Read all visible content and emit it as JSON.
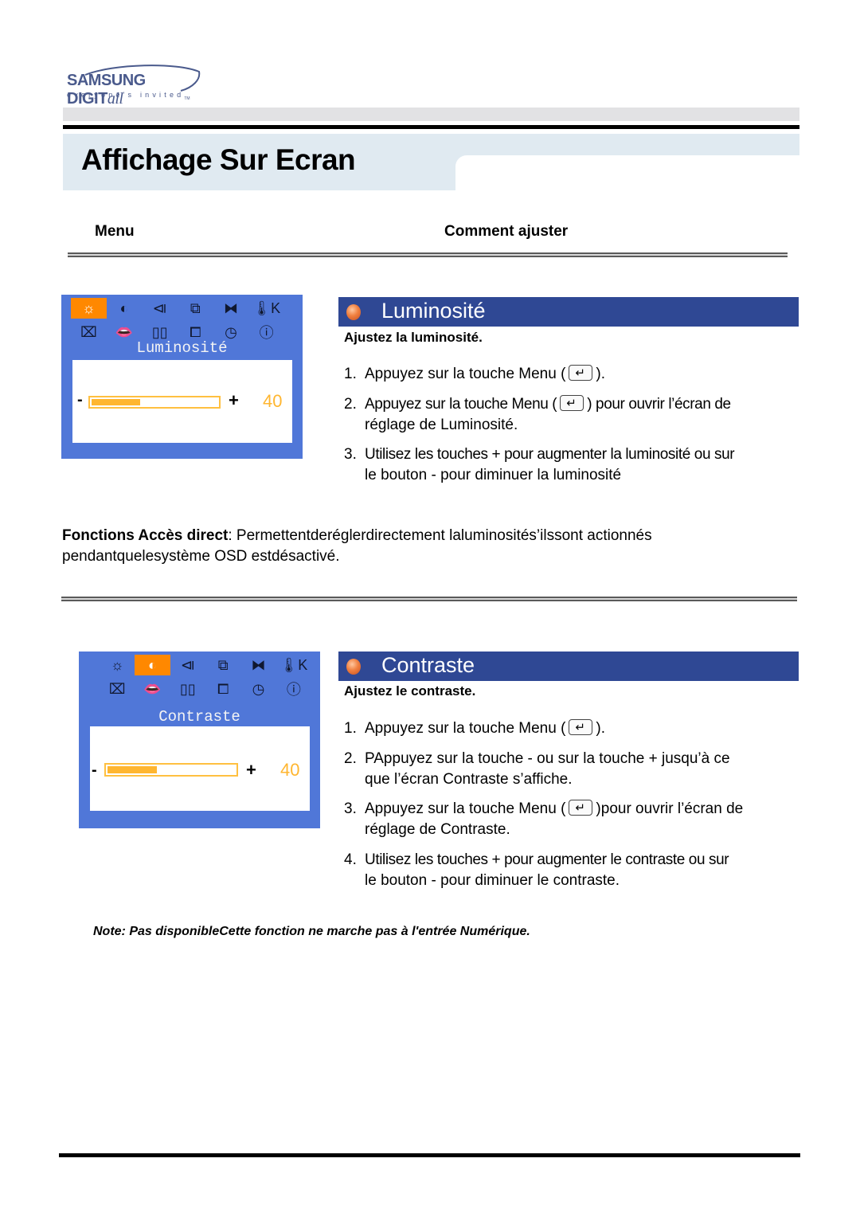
{
  "logo": {
    "brand": "SAMSUNG DIGIT",
    "brand_suffix": "all",
    "tagline": "everyone's invited",
    "tm": "TM"
  },
  "header": {
    "title": "Affichage Sur Ecran"
  },
  "columns": {
    "menu": "Menu",
    "how": "Comment ajuster"
  },
  "osd_icons": [
    {
      "name": "brightness-icon",
      "glyph": "☼"
    },
    {
      "name": "contrast-icon",
      "glyph": "◐"
    },
    {
      "name": "image-lock-icon",
      "glyph": "⧏"
    },
    {
      "name": "position-icon",
      "glyph": "⧉"
    },
    {
      "name": "size-icon",
      "glyph": "⧓"
    },
    {
      "name": "color-temp-icon",
      "glyph": "🌡K"
    },
    {
      "name": "geometry-icon",
      "glyph": "⌧"
    },
    {
      "name": "language-icon",
      "glyph": "👄"
    },
    {
      "name": "zoom-icon",
      "glyph": "▯▯"
    },
    {
      "name": "pip-icon",
      "glyph": "⧠"
    },
    {
      "name": "osd-time-icon",
      "glyph": "◷"
    },
    {
      "name": "info-icon",
      "glyph": "ⓘ"
    }
  ],
  "sections": [
    {
      "id": "luminosite",
      "osd_title": "Luminosité",
      "osd_value": "40",
      "osd_level_percent": 40,
      "osd_minus": "-",
      "osd_plus": "+",
      "selected_icon_index": 0,
      "banner": "Luminosité",
      "subhead": "Ajustez la luminosité.",
      "steps": [
        {
          "num": "1.",
          "before": "Appuyez sur la touche Menu (",
          "after": ").",
          "line2": ""
        },
        {
          "num": "2.",
          "before": "Appuyez sur la touche Menu (",
          "after": ") pour ouvrir l’écran de",
          "line2": "réglage de Luminosité."
        },
        {
          "num": "3.",
          "before": "Utilisez les touches + pour augmenter la luminosité ou sur",
          "after": "",
          "line2": "le bouton - pour diminuer la luminosité"
        }
      ]
    },
    {
      "id": "contraste",
      "osd_title": "Contraste",
      "osd_value": "40",
      "osd_level_percent": 40,
      "osd_minus": "-",
      "osd_plus": "+",
      "selected_icon_index": 1,
      "banner": "Contraste",
      "subhead": "Ajustez le contraste.",
      "steps": [
        {
          "num": "1.",
          "before": "Appuyez sur la touche Menu (",
          "after": ").",
          "line2": ""
        },
        {
          "num": "2.",
          "before": "PAppuyez sur la touche - ou sur la touche + jusqu’à ce",
          "after": "",
          "line2": "que l’écran Contraste s’affiche."
        },
        {
          "num": "3.",
          "before": "Appuyez sur la touche Menu (",
          "after": ")pour ouvrir l’écran de",
          "line2": "réglage de Contraste."
        },
        {
          "num": "4.",
          "before": "Utilisez les touches + pour augmenter le contraste ou sur",
          "after": "",
          "line2": "le bouton - pour diminuer le contraste."
        }
      ]
    }
  ],
  "direct_access": {
    "label": "Fonctions Accès direct",
    "text": ": Permettentderéglerdirectement laluminosités’ilssont actionnés",
    "line2": "pendantquelesystème OSD estdésactivé."
  },
  "note": "Note: Pas disponibleCette fonction ne marche pas à l'entrée Numérique."
}
